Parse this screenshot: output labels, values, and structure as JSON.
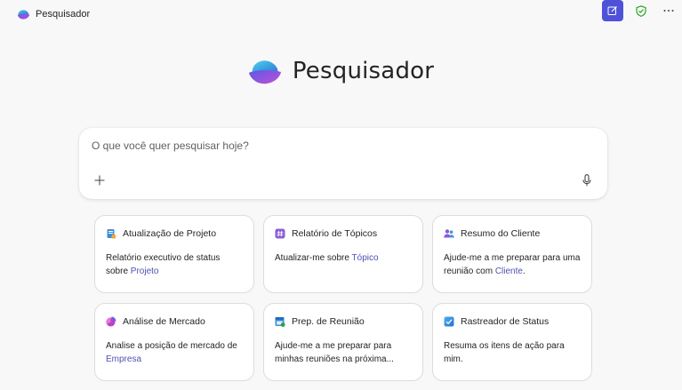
{
  "app": {
    "name": "Pesquisador"
  },
  "hero": {
    "title": "Pesquisador"
  },
  "search": {
    "placeholder": "O que você quer pesquisar hoje?",
    "value": ""
  },
  "cards": [
    {
      "title": "Atualização de Projeto",
      "icon": "document-icon",
      "body_before": "Relatório executivo de status sobre ",
      "link": "Projeto",
      "body_after": ""
    },
    {
      "title": "Relatório de Tópicos",
      "icon": "hashtag-icon",
      "body_before": "Atualizar-me sobre ",
      "link": "Tópico",
      "body_after": ""
    },
    {
      "title": "Resumo do Cliente",
      "icon": "people-icon",
      "body_before": "Ajude-me a me preparar para uma reunião com ",
      "link": "Cliente",
      "body_after": "."
    },
    {
      "title": "Análise de Mercado",
      "icon": "pie-chart-icon",
      "body_before": "Analise a posição de mercado de ",
      "link": "Empresa",
      "body_after": ""
    },
    {
      "title": "Prep. de Reunião",
      "icon": "calendar-icon",
      "body_before": "Ajude-me a me preparar para minhas reuniões na próxima...",
      "link": "",
      "body_after": ""
    },
    {
      "title": "Rastreador de Status",
      "icon": "checkbox-icon",
      "body_before": "Resuma os itens de ação para mim.",
      "link": "",
      "body_after": ""
    }
  ],
  "colors": {
    "accent": "#4f52d9",
    "link": "#4f52b2",
    "shield": "#13a10e"
  }
}
